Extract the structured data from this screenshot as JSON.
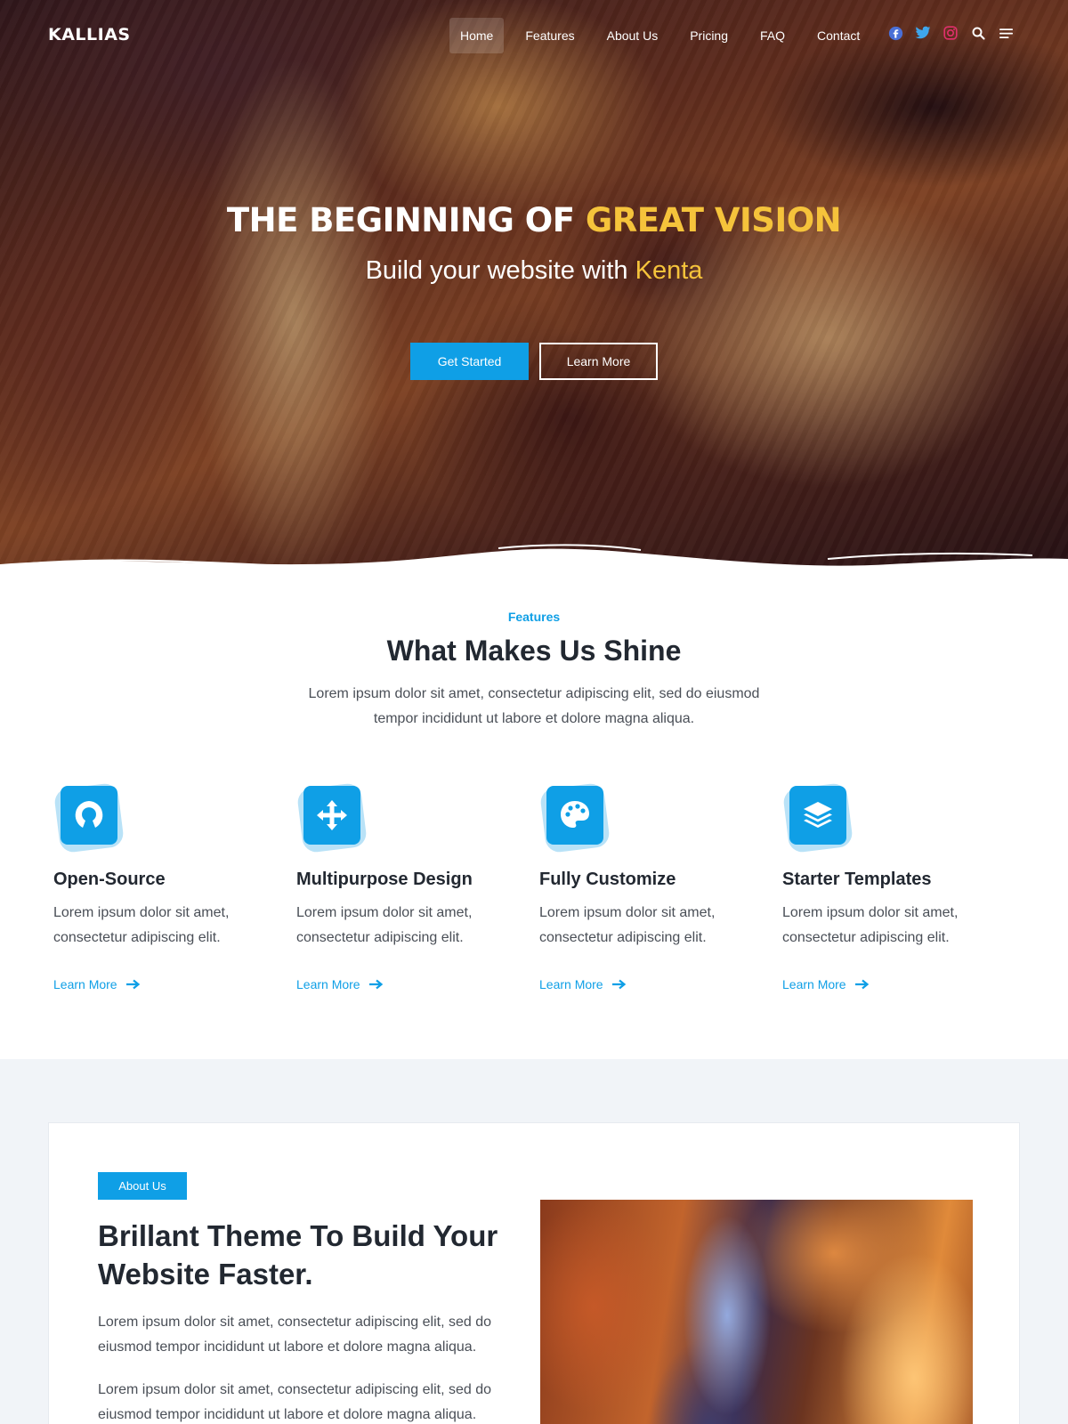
{
  "brand": {
    "logo": "KALLIAS",
    "accent_color": "#0f9fe6",
    "highlight_color": "#f5c33b"
  },
  "nav": {
    "items": [
      {
        "label": "Home",
        "active": true
      },
      {
        "label": "Features",
        "active": false
      },
      {
        "label": "About Us",
        "active": false
      },
      {
        "label": "Pricing",
        "active": false
      },
      {
        "label": "FAQ",
        "active": false
      },
      {
        "label": "Contact",
        "active": false
      }
    ],
    "icons": [
      "facebook-icon",
      "twitter-icon",
      "instagram-icon",
      "search-icon",
      "menu-icon"
    ]
  },
  "hero": {
    "title_main": "THE BEGINNING OF",
    "title_accent": "GREAT VISION",
    "subtitle_main": "Build your website with",
    "subtitle_accent": "Kenta",
    "primary_button": "Get Started",
    "secondary_button": "Learn More"
  },
  "features": {
    "eyebrow": "Features",
    "title": "What Makes Us Shine",
    "description": "Lorem ipsum dolor sit amet, consectetur adipiscing elit, sed do eiusmod tempor incididunt ut labore et dolore magna aliqua.",
    "items": [
      {
        "icon": "open-source-icon",
        "name": "Open-Source",
        "text": "Lorem ipsum dolor sit amet, consectetur adipiscing elit.",
        "link": "Learn More"
      },
      {
        "icon": "move-arrows-icon",
        "name": "Multipurpose Design",
        "text": "Lorem ipsum dolor sit amet, consectetur adipiscing elit.",
        "link": "Learn More"
      },
      {
        "icon": "palette-icon",
        "name": "Fully Customize",
        "text": "Lorem ipsum dolor sit amet, consectetur adipiscing elit.",
        "link": "Learn More"
      },
      {
        "icon": "layers-icon",
        "name": "Starter Templates",
        "text": "Lorem ipsum dolor sit amet, consectetur adipiscing elit.",
        "link": "Learn More"
      }
    ]
  },
  "about": {
    "badge": "About Us",
    "title": "Brillant Theme To Build Your Website Faster.",
    "paragraph_1": "Lorem ipsum dolor sit amet, consectetur adipiscing elit, sed do eiusmod tempor incididunt ut labore et dolore magna aliqua.",
    "paragraph_2": "Lorem ipsum dolor sit amet, consectetur adipiscing elit, sed do eiusmod tempor incididunt ut labore et dolore magna aliqua."
  }
}
